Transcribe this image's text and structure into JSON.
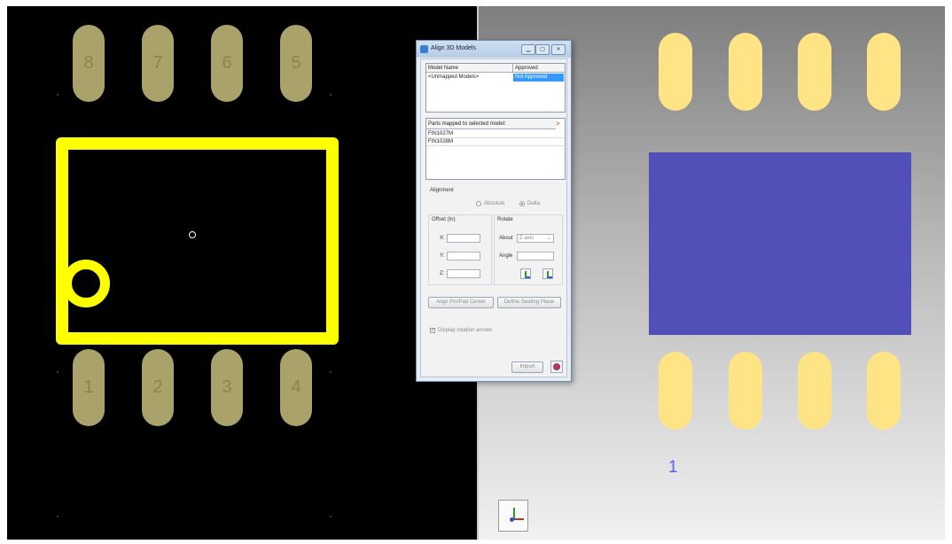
{
  "footprint2d": {
    "top_pins": [
      "8",
      "7",
      "6",
      "5"
    ],
    "bottom_pins": [
      "1",
      "2",
      "3",
      "4"
    ]
  },
  "view3d": {
    "pin1_label": "1"
  },
  "dialog": {
    "title": "Align 3D Models",
    "titlebar_buttons": {
      "minimize": "▁",
      "maximize": "▢",
      "close": "✕"
    },
    "models_table": {
      "columns": [
        "Model Name",
        "Approved"
      ],
      "rows": [
        {
          "name": "<Unmapped Models>",
          "approved": "Not Approved"
        }
      ]
    },
    "parts_list": {
      "header": "Parts mapped to selected model:",
      "items": [
        "FIN1027M",
        "FIN1028M"
      ]
    },
    "alignment": {
      "title": "Alignment",
      "absolute_label": "Absolute",
      "delta_label": "Delta",
      "offset_title": "Offset (In)",
      "x_label": "X:",
      "y_label": "Y:",
      "z_label": "Z:",
      "rotate_title": "Rotate",
      "about_label": "About",
      "about_value": "Z axis",
      "angle_label": "Angle"
    },
    "align_pin_pad_button": "Align Pin/Pad Center",
    "define_seating_plane_button": "Define Seating Plane",
    "display_rotation_arrows": "Display rotation arrows",
    "import_button": "Import"
  },
  "colors": {
    "pad2d": "#a9a26a",
    "silkscreen": "#ffff00",
    "pad3d": "#ffe485",
    "package_body": "#5050b8",
    "selection": "#3399ff"
  }
}
